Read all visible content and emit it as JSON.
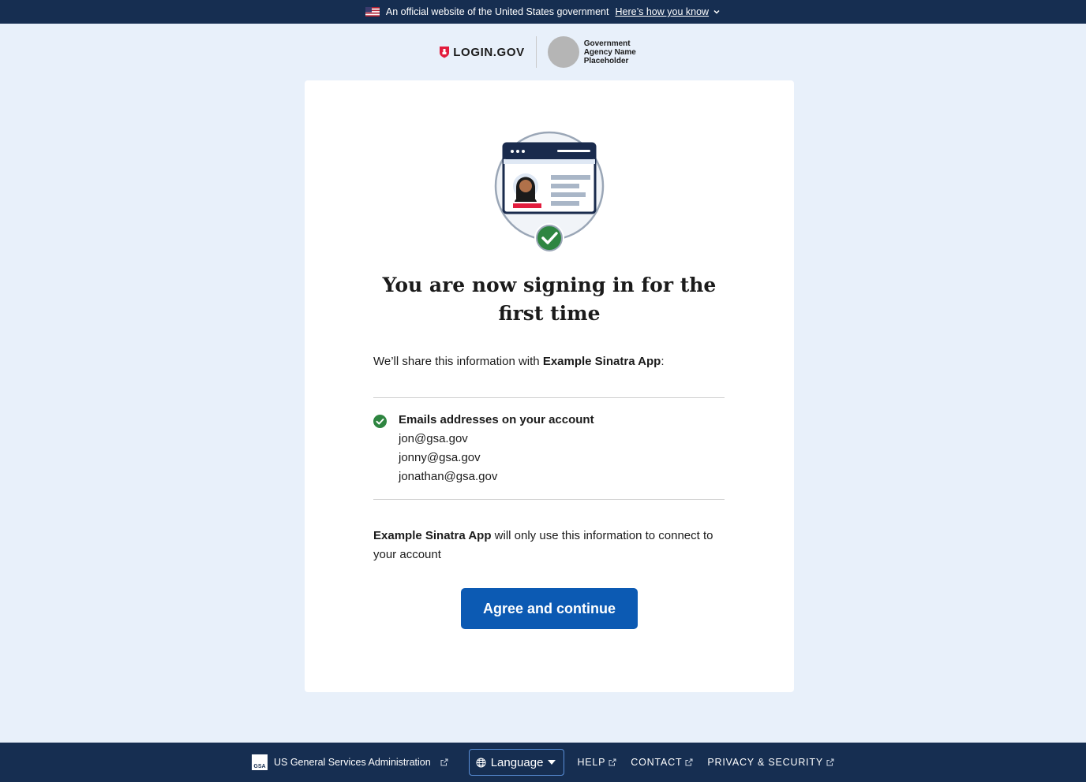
{
  "banner": {
    "official_text": "An official website of the United States government",
    "how_you_know": "Here’s how you know"
  },
  "header": {
    "logo_text": "LOGIN.GOV",
    "agency_line1": "Government",
    "agency_line2": "Agency Name",
    "agency_line3": "Placeholder"
  },
  "main": {
    "title": "You are now signing in for the first time",
    "intro_prefix": "We’ll share this information with ",
    "app_name": "Example Sinatra App",
    "intro_suffix": ":",
    "attribute_title": "Emails addresses on your account",
    "emails": [
      "jon@gsa.gov",
      "jonny@gsa.gov",
      "jonathan@gsa.gov"
    ],
    "usage_suffix": " will only use this information to connect to your account",
    "agree_button": "Agree and continue"
  },
  "footer": {
    "gsa_label": "US General Services Administration",
    "gsa_logo_text": "GSA",
    "language": "Language",
    "help": "HELP",
    "contact": "CONTACT",
    "privacy": "PRIVACY & SECURITY"
  },
  "colors": {
    "banner_bg": "#162e51",
    "page_bg": "#e8f0fa",
    "primary_button": "#0c5ab3",
    "success_green": "#2e8540",
    "brand_red": "#e21c3d"
  },
  "icons": {
    "flag": "us-flag-icon",
    "chevron": "chevron-down-icon",
    "shield": "login-shield-icon",
    "check": "check-circle-icon",
    "globe": "globe-icon",
    "caret": "caret-down-icon",
    "external": "external-link-icon"
  }
}
